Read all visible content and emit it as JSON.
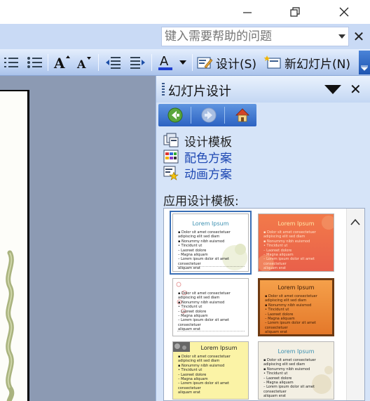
{
  "window": {
    "minimize_glyph": "—",
    "restore_glyph": "❐",
    "close_glyph": "✕"
  },
  "help": {
    "placeholder": "键入需要帮助的问题",
    "close_glyph": "✕"
  },
  "toolbar": {
    "design_label": "设计(S)",
    "new_slide_label": "新幻灯片(N)"
  },
  "task_pane": {
    "title": "幻灯片设计",
    "close_glyph": "✕",
    "links": [
      {
        "label": "设计模板",
        "icon": "design-template-icon",
        "color": "#222222"
      },
      {
        "label": "配色方案",
        "icon": "color-scheme-icon",
        "color": "#1f49b3"
      },
      {
        "label": "动画方案",
        "icon": "animation-scheme-icon",
        "color": "#1f49b3"
      }
    ],
    "section_label": "应用设计模板:",
    "templates": [
      {
        "title": "Lorem Ipsum",
        "selected": true
      },
      {
        "title": "Lorem Ipsum",
        "selected": false
      },
      {
        "title": "",
        "selected": false
      },
      {
        "title": "Lorem Ipsum",
        "selected": false
      },
      {
        "title": "Lorem Ipsum",
        "selected": false
      },
      {
        "title": "Lorem Ipsum",
        "selected": false
      }
    ],
    "thumb_body": "▪ Dolor sit amet consectetuer adipiscing elit sed diam\n  ▪ Nonummy nibh euismod\n    • Tincidunt ut\n      – Laoreet dolore\n        – Magna aliquam\n        – Lorem ipsum dolor sit amet consectetuer\n          aliquam erat"
  },
  "colors": {
    "pane_bg": "#d6e4f8",
    "workspace_bg": "#8c9ab3",
    "toolbar_top": "#e4eefc",
    "toolbar_bottom": "#a9c2ea",
    "nav_bar": "#2c62c2",
    "link_blue": "#1f49b3"
  }
}
